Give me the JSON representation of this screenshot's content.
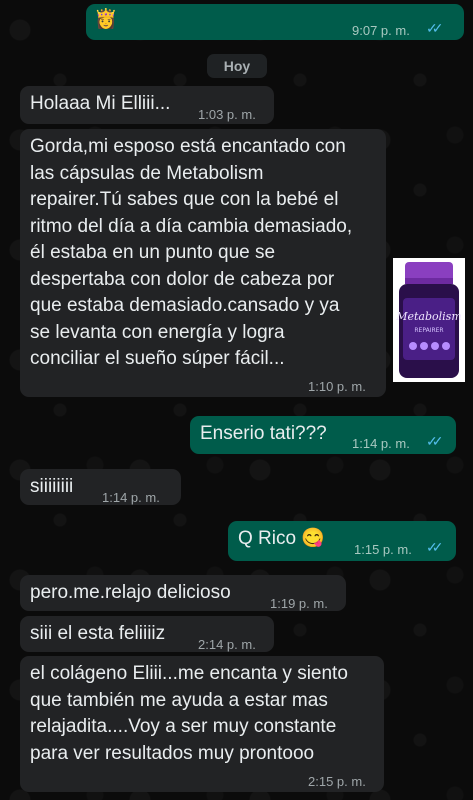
{
  "chat": {
    "date_chip": "Hoy",
    "messages": [
      {
        "dir": "out",
        "text": "👸",
        "time": "9:07 p. m.",
        "read": true
      },
      {
        "dir": "in",
        "text": "Holaaa Mi Elliii...",
        "time": "1:03 p. m."
      },
      {
        "dir": "in",
        "lines": [
          "Gorda,mi esposo está encantado con",
          "las cápsulas de Metabolism",
          "repairer.Tú sabes que con la bebé el",
          "ritmo del día a día cambia demasiado,",
          "él estaba en un punto que se",
          "despertaba con dolor de cabeza por",
          "que estaba demasiado.cansado y ya",
          "se levanta con energía y logra",
          "conciliar el sueño súper fácil..."
        ],
        "time": "1:10 p. m."
      },
      {
        "dir": "out",
        "text": "Enserio tati???",
        "time": "1:14 p. m.",
        "read": true
      },
      {
        "dir": "in",
        "text": "siiiiiiii",
        "time": "1:14 p. m."
      },
      {
        "dir": "out",
        "text": "Q Rico 😋",
        "time": "1:15 p. m.",
        "read": true
      },
      {
        "dir": "in",
        "text": "pero.me.relajo delicioso",
        "time": "1:19 p. m."
      },
      {
        "dir": "in",
        "text": "siii el esta feliiiiz",
        "time": "2:14 p. m."
      },
      {
        "dir": "in",
        "lines": [
          "el colágeno Eliii...me encanta y siento",
          "que también me ayuda a estar mas",
          "relajadita....Voy a ser muy constante",
          "para ver resultados muy prontooo"
        ],
        "time": "2:15 p. m."
      }
    ],
    "product": {
      "brand": "Metabolism",
      "sub": "REPAIRER"
    },
    "colors": {
      "incoming": "#222325",
      "outgoing": "#005c4b",
      "read_ticks": "#53bdeb"
    }
  }
}
